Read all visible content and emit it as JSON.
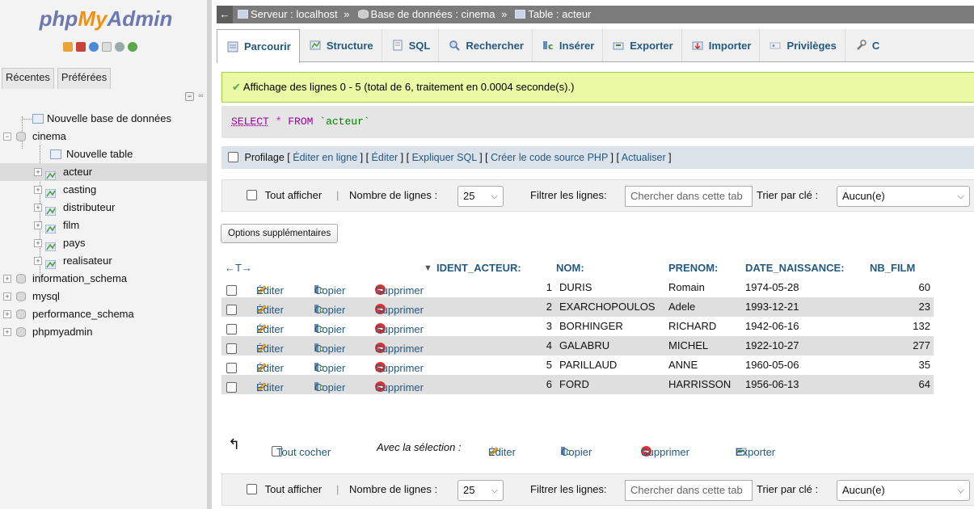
{
  "sidebar": {
    "logo": {
      "php": "php",
      "my": "My",
      "admin": "Admin"
    },
    "tabs": [
      "Récentes",
      "Préférées"
    ],
    "tree": [
      {
        "label": "Nouvelle base de données",
        "kind": "new"
      },
      {
        "label": "cinema",
        "kind": "db"
      },
      {
        "label": "Nouvelle table",
        "kind": "new"
      },
      {
        "label": "acteur",
        "kind": "table",
        "selected": true
      },
      {
        "label": "casting",
        "kind": "table"
      },
      {
        "label": "distributeur",
        "kind": "table"
      },
      {
        "label": "film",
        "kind": "table"
      },
      {
        "label": "pays",
        "kind": "table"
      },
      {
        "label": "realisateur",
        "kind": "table"
      },
      {
        "label": "information_schema",
        "kind": "db"
      },
      {
        "label": "mysql",
        "kind": "db"
      },
      {
        "label": "performance_schema",
        "kind": "db"
      },
      {
        "label": "phpmyadmin",
        "kind": "db"
      }
    ]
  },
  "breadcrumb": {
    "server": "Serveur : localhost",
    "database": "Base de données : cinema",
    "table": "Table : acteur",
    "sep": "»"
  },
  "tabs": [
    "Parcourir",
    "Structure",
    "SQL",
    "Rechercher",
    "Insérer",
    "Exporter",
    "Importer",
    "Privilèges",
    "C"
  ],
  "success": "Affichage des lignes 0 - 5 (total de 6, traitement en 0.0004 seconde(s).)",
  "sql": {
    "select": "SELECT",
    "star": "*",
    "from": "FROM",
    "table": "`acteur`"
  },
  "profil": {
    "label": "Profilage",
    "links": [
      "Éditer en ligne",
      "Éditer",
      "Expliquer SQL",
      "Créer le code source PHP",
      "Actualiser"
    ]
  },
  "nav": {
    "show_all": "Tout afficher",
    "rows_label": "Nombre de lignes :",
    "rows_value": "25",
    "filter_label": "Filtrer les lignes:",
    "filter_placeholder": "Chercher dans cette tab",
    "sort_label": "Trier par clé :",
    "sort_value": "Aucun(e)"
  },
  "options_button": "Options supplémentaires",
  "table": {
    "arrows": "←T→",
    "sort_indicator": "▼",
    "columns": [
      "IDENT_ACTEUR:",
      "NOM:",
      "PRENOM:",
      "DATE_NAISSANCE:",
      "NB_FILM"
    ],
    "actions": {
      "edit": "Éditer",
      "copy": "Copier",
      "delete": "Supprimer"
    },
    "rows": [
      {
        "id": "1",
        "nom": "DURIS",
        "prenom": "Romain",
        "date": "1974-05-28",
        "nb": "60"
      },
      {
        "id": "2",
        "nom": "EXARCHOPOULOS",
        "prenom": "Adele",
        "date": "1993-12-21",
        "nb": "23"
      },
      {
        "id": "3",
        "nom": "BORHINGER",
        "prenom": "RICHARD",
        "date": "1942-06-16",
        "nb": "132"
      },
      {
        "id": "4",
        "nom": "GALABRU",
        "prenom": "MICHEL",
        "date": "1922-10-27",
        "nb": "277"
      },
      {
        "id": "5",
        "nom": "PARILLAUD",
        "prenom": "ANNE",
        "date": "1960-05-06",
        "nb": "35"
      },
      {
        "id": "6",
        "nom": "FORD",
        "prenom": "HARRISSON",
        "date": "1956-06-13",
        "nb": "64"
      }
    ]
  },
  "bulk": {
    "check_all": "Tout cocher",
    "with_selection": "Avec la sélection :",
    "edit": "Éditer",
    "copy": "Copier",
    "delete": "Supprimer",
    "export": "Exporter"
  },
  "colors": {
    "link": "#235a81",
    "success_bg": "#ebf8a4",
    "logo_blue": "#6c78af",
    "logo_orange": "#f29111"
  }
}
